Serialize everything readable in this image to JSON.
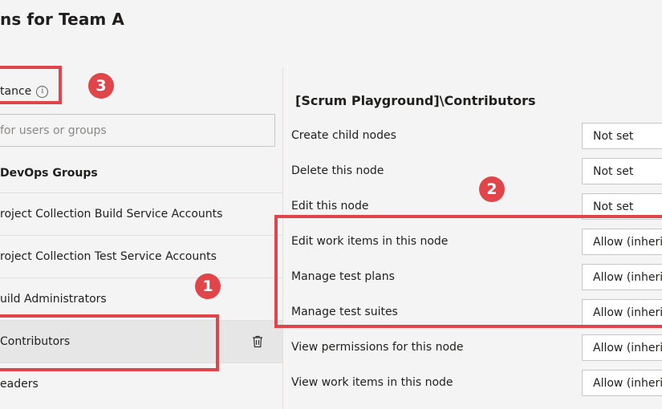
{
  "page": {
    "title": "ns for Team A"
  },
  "left_pane": {
    "inheritance_label": "tance",
    "search_placeholder": "for users or groups",
    "group_header": "DevOps Groups",
    "groups": [
      {
        "label": "roject Collection Build Service Accounts",
        "selected": false
      },
      {
        "label": "roject Collection Test Service Accounts",
        "selected": false
      },
      {
        "label": "uild Administrators",
        "selected": false
      },
      {
        "label": "Contributors",
        "selected": true
      },
      {
        "label": "eaders",
        "selected": false
      }
    ]
  },
  "right_pane": {
    "title": "[Scrum Playground]\\Contributors",
    "permissions": [
      {
        "name": "Create child nodes",
        "value": "Not set"
      },
      {
        "name": "Delete this node",
        "value": "Not set"
      },
      {
        "name": "Edit this node",
        "value": "Not set"
      },
      {
        "name": "Edit work items in this node",
        "value": "Allow (inherited)"
      },
      {
        "name": "Manage test plans",
        "value": "Allow (inherited)"
      },
      {
        "name": "Manage test suites",
        "value": "Allow (inherited)"
      },
      {
        "name": "View permissions for this node",
        "value": "Allow (inherited)"
      },
      {
        "name": "View work items in this node",
        "value": "Allow (inherited)"
      }
    ]
  },
  "annotations": {
    "badge_1": "1",
    "badge_2": "2",
    "badge_3": "3",
    "color": "#e0454a"
  },
  "icons": {
    "info": "info-icon",
    "delete": "trash-icon"
  }
}
